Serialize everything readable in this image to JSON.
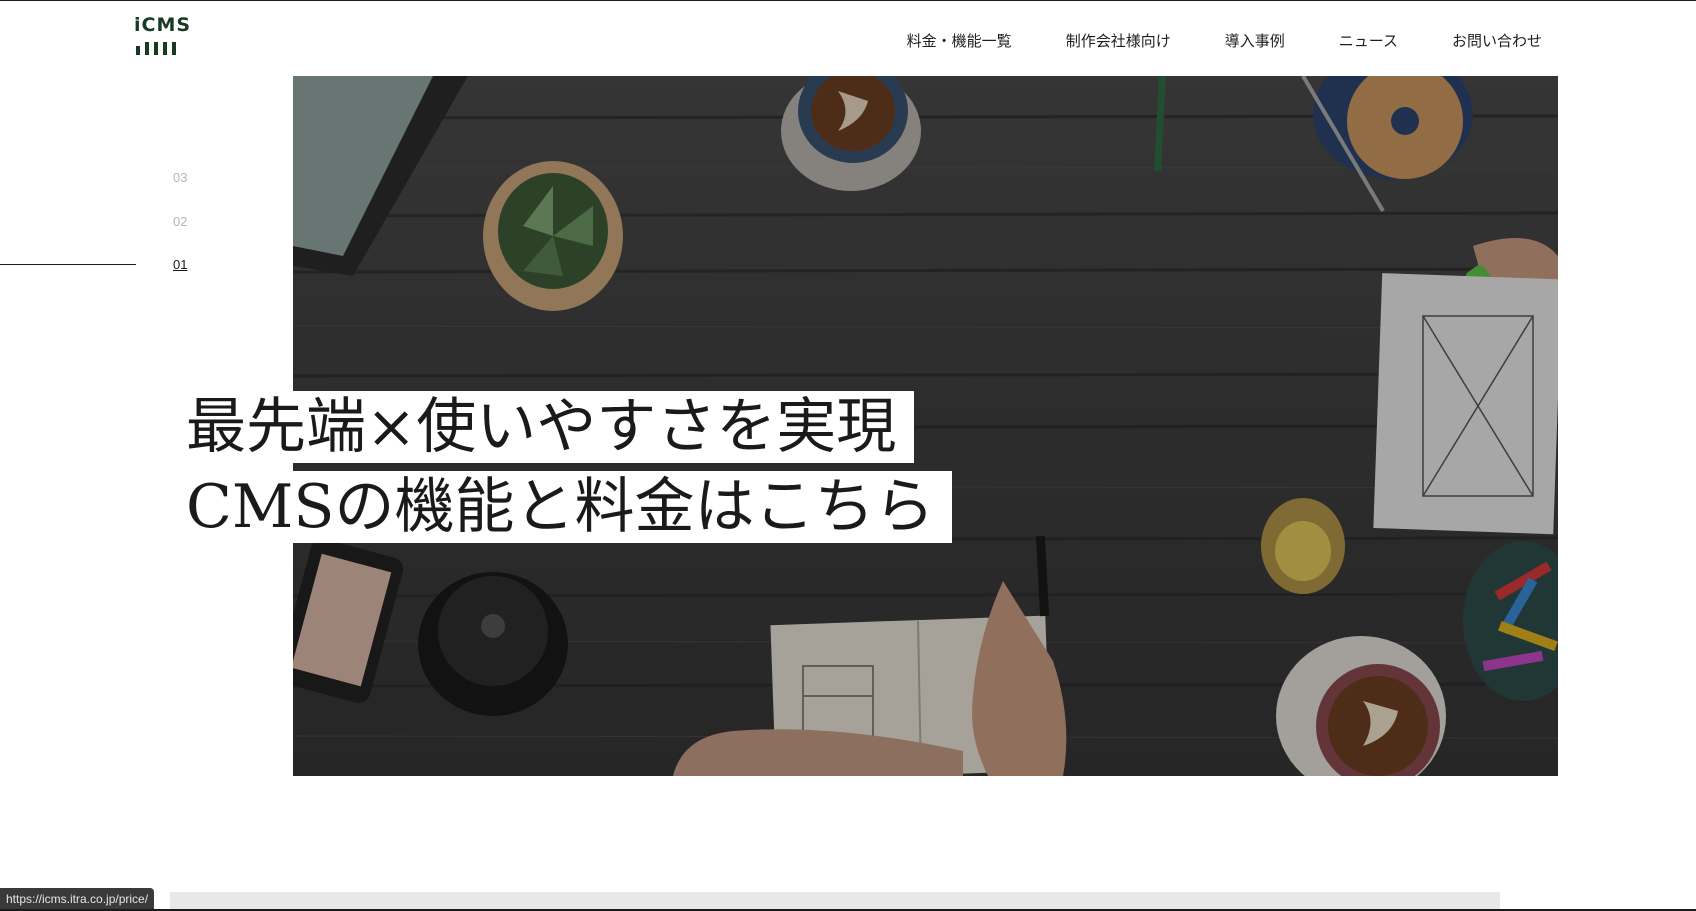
{
  "brand": {
    "logo_text": "iCMS",
    "color": "#163a22"
  },
  "nav": {
    "items": [
      {
        "label": "料金・機能一覧"
      },
      {
        "label": "制作会社様向け"
      },
      {
        "label": "導入事例"
      },
      {
        "label": "ニュース"
      },
      {
        "label": "お問い合わせ"
      }
    ]
  },
  "slider": {
    "indicators": [
      "03",
      "02",
      "01"
    ],
    "active": "01"
  },
  "hero": {
    "headline_line1": "最先端×使いやすさを実現",
    "headline_line2": "CMSの機能と料金はこちら",
    "image": "dark wooden table top view with coffee cups, laptop, notebook and hands"
  },
  "status": {
    "url": "https://icms.itra.co.jp/price/"
  }
}
